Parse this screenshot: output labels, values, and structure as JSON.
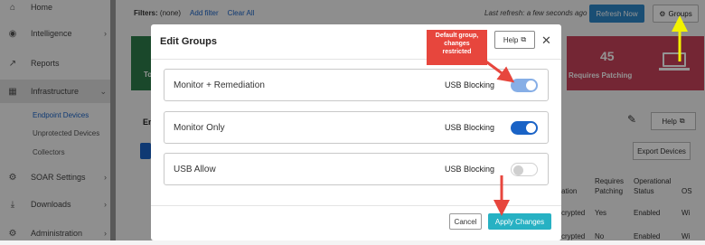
{
  "sidebar": {
    "items": [
      {
        "label": "Home",
        "icon": "home-icon"
      },
      {
        "label": "Intelligence",
        "icon": "intelligence-icon"
      },
      {
        "label": "Reports",
        "icon": "reports-icon"
      },
      {
        "label": "Infrastructure",
        "icon": "infrastructure-icon"
      },
      {
        "label": "SOAR Settings",
        "icon": "soar-icon"
      },
      {
        "label": "Downloads",
        "icon": "download-icon"
      },
      {
        "label": "Administration",
        "icon": "admin-icon"
      }
    ],
    "subitems": [
      "Endpoint Devices",
      "Unprotected Devices",
      "Collectors"
    ]
  },
  "topbar": {
    "filters_label": "Filters:",
    "filters_value": "(none)",
    "add_filter": "Add filter",
    "clear_all": "Clear All",
    "last_refresh": "Last refresh: a few seconds ago",
    "refresh_button": "Refresh Now",
    "groups_button": "Groups"
  },
  "cards": {
    "green_label": "To",
    "red_count": "45",
    "red_label": "Requires Patching"
  },
  "background": {
    "section_title": "En",
    "help_label": "Help",
    "export_label": "Export Devices",
    "columns": [
      "ation",
      "Requires Patching",
      "Operational Status",
      "OS"
    ],
    "rows": [
      [
        "crypted",
        "Yes",
        "Enabled",
        "Wi"
      ],
      [
        "crypted",
        "No",
        "Enabled",
        "Wi"
      ]
    ]
  },
  "modal": {
    "title": "Edit Groups",
    "help_label": "Help",
    "cancel_label": "Cancel",
    "apply_label": "Apply Changes",
    "groups": [
      {
        "name": "Monitor + Remediation",
        "setting": "USB Blocking",
        "enabled": true,
        "disabled_control": true
      },
      {
        "name": "Monitor Only",
        "setting": "USB Blocking",
        "enabled": true,
        "disabled_control": false
      },
      {
        "name": "USB Allow",
        "setting": "USB Blocking",
        "enabled": false,
        "disabled_control": false
      }
    ]
  },
  "callout": {
    "lines": [
      "Default group,",
      "changes",
      "restricted"
    ]
  },
  "colors": {
    "toggle_on": "#1a63c6",
    "toggle_restricted": "#86aee6",
    "apply": "#27b1c3",
    "card_red": "#c8425a",
    "card_green": "#2e7d4a",
    "annotation_red": "#e7463d",
    "annotation_yellow": "#f2f200"
  }
}
